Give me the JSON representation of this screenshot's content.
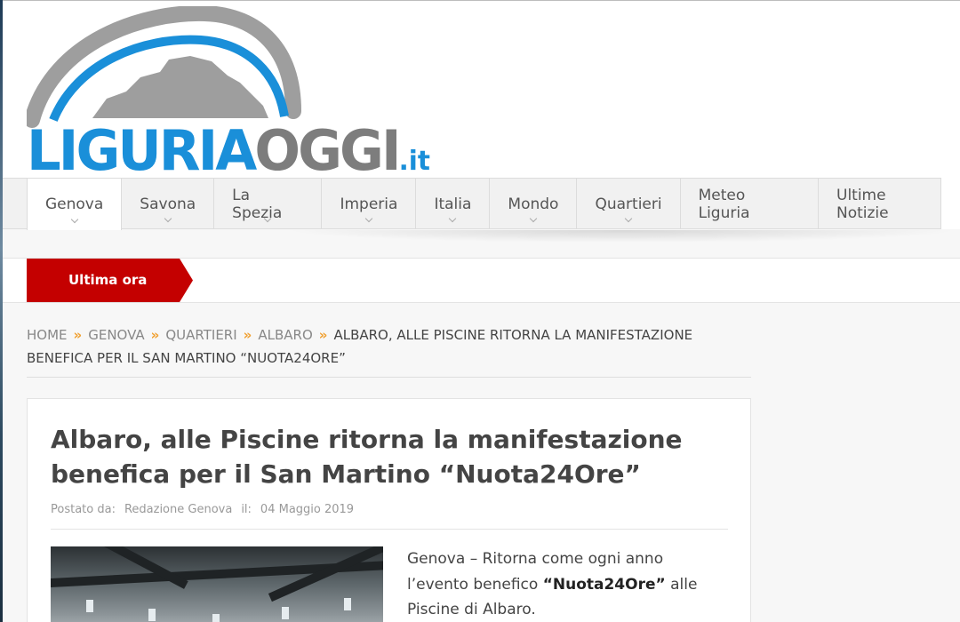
{
  "brand": {
    "liguria": "LIGURIA",
    "oggi": "OGGI",
    "tld": ".it",
    "colors": {
      "blue": "#1a8fd9",
      "gray": "#7d7d7d",
      "red": "#c40000",
      "chevron": "#f0a030"
    }
  },
  "nav": {
    "items": [
      {
        "label": "Genova",
        "active": true,
        "dropdown": true
      },
      {
        "label": "Savona",
        "dropdown": true
      },
      {
        "label": "La Spezia",
        "dropdown": true
      },
      {
        "label": "Imperia",
        "dropdown": true
      },
      {
        "label": "Italia",
        "dropdown": true
      },
      {
        "label": "Mondo",
        "dropdown": true
      },
      {
        "label": "Quartieri",
        "dropdown": true
      },
      {
        "label": "Meteo Liguria",
        "dropdown": false
      },
      {
        "label": "Ultime Notizie",
        "dropdown": false
      }
    ]
  },
  "ticker": {
    "label": "Ultima ora"
  },
  "breadcrumb": {
    "items": [
      "HOME",
      "GENOVA",
      "QUARTIERI",
      "ALBARO"
    ],
    "current": "ALBARO, ALLE PISCINE RITORNA LA MANIFESTAZIONE BENEFICA PER IL SAN MARTINO “NUOTA24ORE”"
  },
  "article": {
    "title": "Albaro, alle Piscine ritorna la manifestazione benefica per il San Martino “Nuota24Ore”",
    "posted_by_label": "Postato da:",
    "author": "Redazione Genova",
    "date_label": "il:",
    "date": "04 Maggio 2019",
    "intro_before": "Genova – Ritorna come ogni anno l’evento benefico ",
    "intro_bold": "“Nuota24Ore”",
    "intro_after": " alle Piscine di Albaro."
  }
}
